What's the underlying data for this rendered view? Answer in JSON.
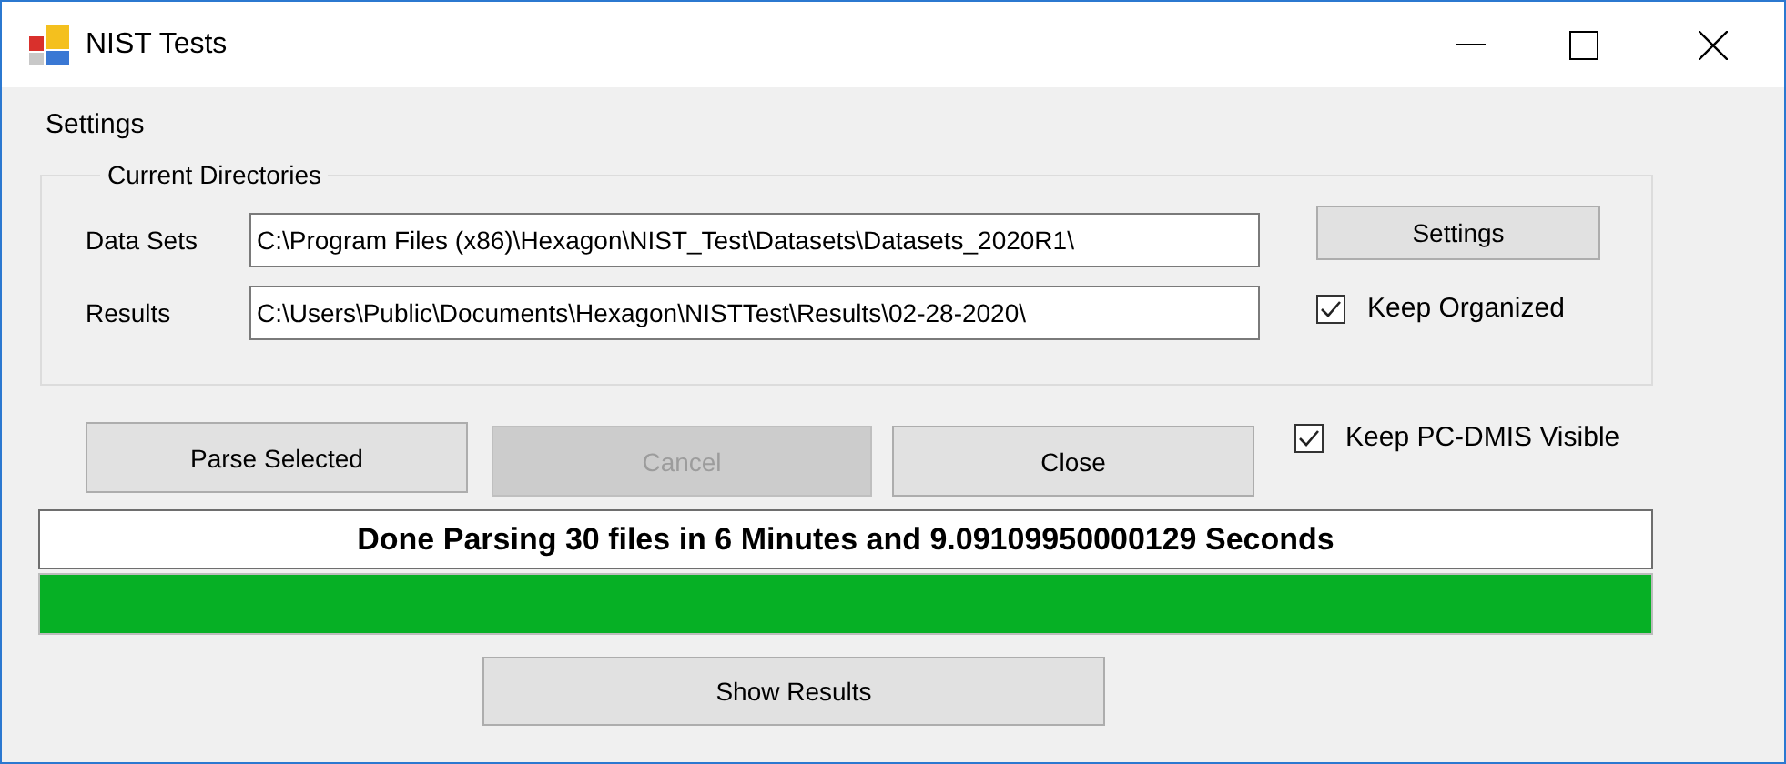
{
  "window": {
    "title": "NIST Tests"
  },
  "menu": [
    "Settings"
  ],
  "group": {
    "title": "Current Directories",
    "fields": [
      {
        "label": "Data Sets",
        "value": "C:\\Program Files (x86)\\Hexagon\\NIST_Test\\Datasets\\Datasets_2020R1\\"
      },
      {
        "label": "Results",
        "value": "C:\\Users\\Public\\Documents\\Hexagon\\NISTTest\\Results\\02-28-2020\\"
      }
    ],
    "button": {
      "label": "Settings"
    },
    "checkbox": {
      "label": "Keep Organized",
      "checked": true
    }
  },
  "actions": [
    {
      "label": "Parse Selected",
      "disabled": false
    },
    {
      "label": "Cancel",
      "disabled": true
    },
    {
      "label": "Close",
      "disabled": false
    }
  ],
  "visible_checkbox": {
    "label": "Keep PC-DMIS Visible",
    "checked": true
  },
  "status": "Done Parsing 30 files in 6 Minutes and 9.09109950000129 Seconds",
  "progress": {
    "level": 1
  },
  "show_button": {
    "label": "Show Results"
  }
}
